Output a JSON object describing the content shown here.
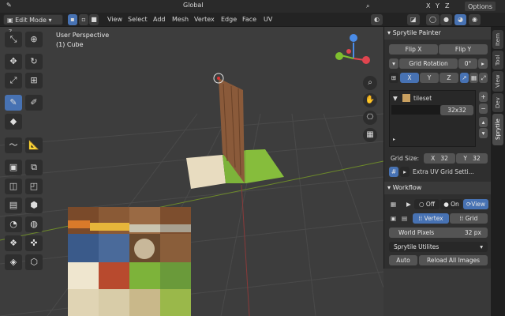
{
  "header": {
    "mode": "Edit Mode",
    "menu": [
      "View",
      "Select",
      "Add",
      "Mesh",
      "Vertex",
      "Edge",
      "Face",
      "UV"
    ],
    "orientation": "Global",
    "axes": [
      "X",
      "Y",
      "Z"
    ],
    "options": "Options"
  },
  "viewport": {
    "perspective": "User Perspective",
    "object": "(1) Cube",
    "gizmo": {
      "z": "Z",
      "y": "Y",
      "x": "X"
    }
  },
  "sprytile": {
    "title": "Sprytile Painter",
    "flip_x": "Flip X",
    "flip_y": "Flip Y",
    "grid_rotation_label": "Grid Rotation",
    "grid_rotation_value": "0°",
    "axis_x": "X",
    "axis_y": "Y",
    "axis_z": "Z",
    "tileset_name": "tileset",
    "tile_size": "32x32",
    "grid_size_label": "Grid Size:",
    "grid_x_label": "X",
    "grid_x_value": "32",
    "grid_y_label": "Y",
    "grid_y_value": "32",
    "extra_uv": "Extra UV Grid Setti..."
  },
  "workflow": {
    "title": "Workflow",
    "off": "Off",
    "on": "On",
    "view": "View",
    "vertex": "Vertex",
    "grid": "Grid",
    "world_pixels_label": "World Pixels",
    "world_pixels_value": "32 px",
    "utilities": "Sprytile Utilites",
    "auto": "Auto",
    "reload": "Reload All Images"
  },
  "tabs": [
    "Item",
    "Tool",
    "View",
    "Dev",
    "Sprytile"
  ],
  "colors": {
    "accent": "#4772b3",
    "x_axis": "#e0454f",
    "y_axis": "#7fbf2f",
    "z_axis": "#4a8ce8"
  }
}
